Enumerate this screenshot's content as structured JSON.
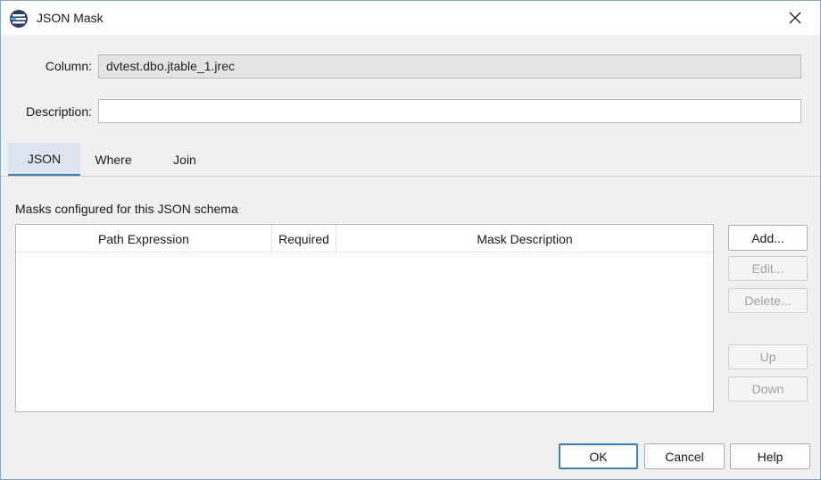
{
  "window": {
    "title": "JSON Mask"
  },
  "form": {
    "column_label": "Column:",
    "column_value": "dvtest.dbo.jtable_1.jrec",
    "description_label": "Description:",
    "description_value": ""
  },
  "tabs": [
    {
      "label": "JSON",
      "active": true
    },
    {
      "label": "Where",
      "active": false
    },
    {
      "label": "Join",
      "active": false
    }
  ],
  "masks": {
    "section_label": "Masks configured for this JSON schema",
    "columns": [
      "Path Expression",
      "Required",
      "Mask Description"
    ],
    "rows": []
  },
  "side_buttons": {
    "add": "Add...",
    "edit": "Edit...",
    "delete": "Delete...",
    "up": "Up",
    "down": "Down"
  },
  "footer_buttons": {
    "ok": "OK",
    "cancel": "Cancel",
    "help": "Help"
  },
  "colors": {
    "accent": "#3c7fb1",
    "active_tab_bg": "#dae5f0",
    "readonly_field_bg": "#e4e4e4"
  }
}
